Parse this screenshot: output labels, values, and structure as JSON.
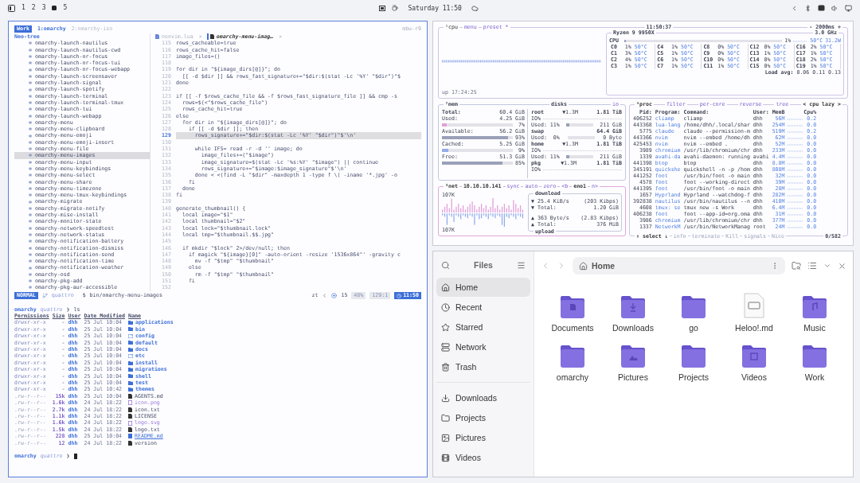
{
  "top_bar": {
    "workspaces": [
      {
        "label": "1",
        "selected": false
      },
      {
        "label": "2",
        "selected": false
      },
      {
        "label": "3",
        "selected": false
      },
      {
        "selected": true
      },
      {
        "label": "5",
        "selected": false
      }
    ],
    "clock": "Saturday 11:50"
  },
  "terminal": {
    "tmux": {
      "session": "Work",
      "windows": [
        {
          "label": "1:omarchy",
          "selected": true
        },
        {
          "label": "2:omarchy-iso",
          "selected": false
        }
      ],
      "host": "mbu-r9"
    },
    "tree": {
      "title": "Neo-tree",
      "items": [
        {
          "label": "omarchy-launch-nautilus",
          "selected": false
        },
        {
          "label": "omarchy-launch-nautilus-cwd",
          "selected": false
        },
        {
          "label": "omarchy-launch-or-focus",
          "selected": false
        },
        {
          "label": "omarchy-launch-or-focus-tui",
          "selected": false
        },
        {
          "label": "omarchy-launch-or-focus-webapp",
          "selected": false
        },
        {
          "label": "omarchy-launch-screensaver",
          "selected": false
        },
        {
          "label": "omarchy-launch-signal",
          "selected": false
        },
        {
          "label": "omarchy-launch-spotify",
          "selected": false
        },
        {
          "label": "omarchy-launch-terminal",
          "selected": false
        },
        {
          "label": "omarchy-launch-terminal-tmux",
          "selected": false
        },
        {
          "label": "omarchy-launch-tui",
          "selected": false
        },
        {
          "label": "omarchy-launch-webapp",
          "selected": false
        },
        {
          "label": "omarchy-menu",
          "selected": false
        },
        {
          "label": "omarchy-menu-clipboard",
          "selected": false
        },
        {
          "label": "omarchy-menu-emoji",
          "selected": false
        },
        {
          "label": "omarchy-menu-emoji-insert",
          "selected": false
        },
        {
          "label": "omarchy-menu-file",
          "selected": false
        },
        {
          "label": "omarchy-menu-images",
          "selected": true
        },
        {
          "label": "omarchy-menu-input",
          "selected": false
        },
        {
          "label": "omarchy-menu-keybindings",
          "selected": false
        },
        {
          "label": "omarchy-menu-select",
          "selected": false
        },
        {
          "label": "omarchy-menu-share",
          "selected": false
        },
        {
          "label": "omarchy-menu-timezone",
          "selected": false
        },
        {
          "label": "omarchy-menu-tmux-keybindings",
          "selected": false
        },
        {
          "label": "omarchy-migrate",
          "selected": false
        },
        {
          "label": "omarchy-migrate-notify",
          "selected": false
        },
        {
          "label": "omarchy-mise-install",
          "selected": false
        },
        {
          "label": "omarchy-monitor-state",
          "selected": false
        },
        {
          "label": "omarchy-network-speedtest",
          "selected": false
        },
        {
          "label": "omarchy-network-status",
          "selected": false
        },
        {
          "label": "omarchy-notification-battery",
          "selected": false
        },
        {
          "label": "omarchy-notification-dismiss",
          "selected": false
        },
        {
          "label": "omarchy-notification-send",
          "selected": false
        },
        {
          "label": "omarchy-notification-time",
          "selected": false
        },
        {
          "label": "omarchy-notification-weather",
          "selected": false
        },
        {
          "label": "omarchy-osd",
          "selected": false
        },
        {
          "label": "omarchy-pkg-add",
          "selected": false
        },
        {
          "label": "omarchy-pkg-aur-accessible",
          "selected": false
        }
      ]
    },
    "editor": {
      "tabs": [
        {
          "label": "neovim.lua",
          "close": "×",
          "selected": false
        },
        {
          "label": "omarchy-menu-imag…",
          "close": "×",
          "selected": true
        }
      ],
      "lines": [
        {
          "n": "115",
          "code": "rows_cacheable=true",
          "selected": false
        },
        {
          "n": "116",
          "code": "rows_cache_hit=false",
          "selected": false
        },
        {
          "n": "117",
          "code": "image_files=()",
          "selected": false
        },
        {
          "n": "118",
          "selected": false
        },
        {
          "n": "119",
          "code": "for dir in \"${image_dirs[@]}\"; do",
          "selected": false
        },
        {
          "n": "120",
          "code": "  [[ -d $dir ]] && rows_fast_signature+=\"$dir:$(stat -Lc '%Y' \"$dir\")\"$",
          "selected": false
        },
        {
          "n": "121",
          "code": "done",
          "selected": false
        },
        {
          "n": "122",
          "selected": false
        },
        {
          "n": "123",
          "code": "if [[ -f $rows_cache_file && -f $rows_fast_signature_file ]] && cmp -s",
          "selected": false
        },
        {
          "n": "124",
          "code": "  rows=$(<\"$rows_cache_file\")",
          "selected": false
        },
        {
          "n": "125",
          "code": "  rows_cache_hit=true",
          "selected": false
        },
        {
          "n": "126",
          "code": "else",
          "selected": false
        },
        {
          "n": "127",
          "code": "  for dir in \"${image_dirs[@]}\"; do",
          "selected": false
        },
        {
          "n": "128",
          "code": "    if [[ -d $dir ]]; then",
          "selected": false
        },
        {
          "n": "129",
          "code": "      rows_signature+=\"$dir:$(stat -Lc '%Y' \"$dir\")\"$'\\n'",
          "selected": true
        },
        {
          "n": "130",
          "selected": false
        },
        {
          "n": "131",
          "code": "      while IFS= read -r -d '' image; do",
          "selected": false
        },
        {
          "n": "132",
          "code": "        image_files+=(\"$image\")",
          "selected": false
        },
        {
          "n": "133",
          "code": "        image_signature=$(stat -Lc '%s:%Y' \"$image\") || continue",
          "selected": false
        },
        {
          "n": "134",
          "code": "        rows_signature+=\"$image:$image_signature\"$'\\n'",
          "selected": false
        },
        {
          "n": "135",
          "code": "      done < <(find -L \"$dir\" -maxdepth 1 -type f \\( -iname '*.jpg' -o",
          "selected": false
        },
        {
          "n": "136",
          "code": "    fi",
          "selected": false
        },
        {
          "n": "137",
          "code": "  done",
          "selected": false
        },
        {
          "n": "138",
          "code": "fi",
          "selected": false
        },
        {
          "n": "139",
          "selected": false
        },
        {
          "n": "140",
          "code": "generate_thumbnail() {",
          "selected": false
        },
        {
          "n": "141",
          "code": "  local image=\"$1\"",
          "selected": false
        },
        {
          "n": "142",
          "code": "  local thumbnail=\"$2\"",
          "selected": false
        },
        {
          "n": "143",
          "code": "  local lock=\"$thumbnail.lock\"",
          "selected": false
        },
        {
          "n": "144",
          "code": "  local tmp=\"$thumbnail.$$.jpg\"",
          "selected": false
        },
        {
          "n": "145",
          "selected": false
        },
        {
          "n": "146",
          "code": "  if mkdir \"$lock\" 2>/dev/null; then",
          "selected": false
        },
        {
          "n": "147",
          "code": "    if magick \"${image}[0]\" -auto-orient -resize '1536x864^' -gravity c",
          "selected": false
        },
        {
          "n": "148",
          "code": "      mv -f \"$tmp\" \"$thumbnail\"",
          "selected": false
        },
        {
          "n": "149",
          "code": "    else",
          "selected": false
        },
        {
          "n": "150",
          "code": "      rm -f \"$tmp\" \"$thumbnail\"",
          "selected": false
        },
        {
          "n": "151",
          "code": "    fi",
          "selected": false
        },
        {
          "n": "152",
          "selected": false
        }
      ]
    },
    "statusline": {
      "mode": "NORMAL",
      "branch": "quattro",
      "shell": "$",
      "file": "bin/omarchy-menu-images",
      "motion": "zt",
      "count": "15",
      "percent": "48%",
      "position": "129:1",
      "time": "11:50"
    },
    "shell": {
      "prompt": {
        "dir": "omarchy",
        "branch": "quattro",
        "symbol": "❯",
        "command": "ls"
      },
      "columns": [
        "Permissions",
        "Size",
        "User",
        "Date Modified",
        "Name"
      ],
      "rows": [
        {
          "perms": "drwxr-xr-x",
          "size": "-",
          "user": "dhh",
          "date": "25 Jul 10:04",
          "name": "applications",
          "kind": "dir"
        },
        {
          "perms": "drwxr-xr-x",
          "size": "-",
          "user": "dhh",
          "date": "25 Jul 10:04",
          "name": "bin",
          "kind": "dir"
        },
        {
          "perms": "drwxr-xr-x",
          "size": "-",
          "user": "dhh",
          "date": "25 Jul 10:04",
          "name": "config",
          "kind": "link"
        },
        {
          "perms": "drwxr-xr-x",
          "size": "-",
          "user": "dhh",
          "date": "25 Jul 10:04",
          "name": "default",
          "kind": "dir"
        },
        {
          "perms": "drwxr-xr-x",
          "size": "-",
          "user": "dhh",
          "date": "25 Jul 10:04",
          "name": "docs",
          "kind": "dir"
        },
        {
          "perms": "drwxr-xr-x",
          "size": "-",
          "user": "dhh",
          "date": "25 Jul 10:04",
          "name": "etc",
          "kind": "link"
        },
        {
          "perms": "drwxr-xr-x",
          "size": "-",
          "user": "dhh",
          "date": "25 Jul 10:04",
          "name": "install",
          "kind": "dir"
        },
        {
          "perms": "drwxr-xr-x",
          "size": "-",
          "user": "dhh",
          "date": "25 Jul 10:04",
          "name": "migrations",
          "kind": "dir"
        },
        {
          "perms": "drwxr-xr-x",
          "size": "-",
          "user": "dhh",
          "date": "25 Jul 10:04",
          "name": "shell",
          "kind": "dir"
        },
        {
          "perms": "drwxr-xr-x",
          "size": "-",
          "user": "dhh",
          "date": "25 Jul 10:04",
          "name": "test",
          "kind": "dir"
        },
        {
          "perms": "drwxr-xr-x",
          "size": "-",
          "user": "dhh",
          "date": "25 Jul 10:42",
          "name": "themes",
          "kind": "dir"
        },
        {
          "perms": ".rw-r--r--",
          "size": "15k",
          "user": "dhh",
          "date": "25 Jul 10:04",
          "name": "AGENTS.md",
          "kind": "file"
        },
        {
          "perms": ".rw-r--r--",
          "size": "1.6k",
          "user": "dhh",
          "date": "24 Jul 18:22",
          "name": "icon.png",
          "kind": "image"
        },
        {
          "perms": ".rw-r--r--",
          "size": "2.7k",
          "user": "dhh",
          "date": "24 Jul 18:22",
          "name": "icon.txt",
          "kind": "file"
        },
        {
          "perms": ".rw-r--r--",
          "size": "1.1k",
          "user": "dhh",
          "date": "24 Jul 18:22",
          "name": "LICENSE",
          "kind": "file"
        },
        {
          "perms": ".rw-r--r--",
          "size": "1.6k",
          "user": "dhh",
          "date": "24 Jul 18:22",
          "name": "logo.svg",
          "kind": "image"
        },
        {
          "perms": ".rw-r--r--",
          "size": "1.5k",
          "user": "dhh",
          "date": "24 Jul 18:22",
          "name": "logo.txt",
          "kind": "file"
        },
        {
          "perms": ".rw-r--r--",
          "size": "228",
          "user": "dhh",
          "date": "25 Jul 10:04",
          "name": "README.md",
          "kind": "doc"
        },
        {
          "perms": ".rw-r--r--",
          "size": "12",
          "user": "dhh",
          "date": "24 Jul 18:22",
          "name": "version",
          "kind": "file"
        }
      ],
      "prompt2": {
        "dir": "omarchy",
        "branch": "quattro",
        "symbol": "❯"
      }
    }
  },
  "btop": {
    "cpu": {
      "tabs": [
        "¹cpu",
        "menu",
        "preset *"
      ],
      "clock": "11:50:37",
      "interval": "- 2000ms +",
      "model": "Ryzen 9 9950X",
      "freq": "3.0 GHz",
      "total": {
        "label": "CPU",
        "level": 0.01,
        "pct": "1%",
        "temp": "50°C",
        "power": "31.2W"
      },
      "cores": [
        {
          "name": "C0",
          "pct": "1%",
          "temp": "50°C"
        },
        {
          "name": "C1",
          "pct": "3%",
          "temp": "50°C"
        },
        {
          "name": "C2",
          "pct": "4%",
          "temp": "50°C"
        },
        {
          "name": "C3",
          "pct": "1%",
          "temp": "50°C"
        },
        {
          "name": "C4",
          "pct": "1%",
          "temp": "50°C"
        },
        {
          "name": "C5",
          "pct": "1%",
          "temp": "50°C"
        },
        {
          "name": "C6",
          "pct": "1%",
          "temp": "50°C"
        },
        {
          "name": "C7",
          "pct": "1%",
          "temp": "50°C"
        },
        {
          "name": "C8",
          "pct": "0%",
          "temp": "50°C"
        },
        {
          "name": "C9",
          "pct": "0%",
          "temp": "50°C"
        },
        {
          "name": "C10",
          "pct": "0%",
          "temp": "50°C"
        },
        {
          "name": "C11",
          "pct": "1%",
          "temp": "50°C"
        },
        {
          "name": "C12",
          "pct": "0%",
          "temp": "50°C"
        },
        {
          "name": "C13",
          "pct": "1%",
          "temp": "50°C"
        },
        {
          "name": "C14",
          "pct": "0%",
          "temp": "50°C"
        },
        {
          "name": "C15",
          "pct": "0%",
          "temp": "50°C"
        },
        {
          "name": "C16",
          "pct": "2%",
          "temp": "50°C"
        },
        {
          "name": "C17",
          "pct": "1%",
          "temp": "50°C"
        },
        {
          "name": "C18",
          "pct": "2%",
          "temp": "50°C"
        },
        {
          "name": "C19",
          "pct": "1%",
          "temp": "50°C"
        }
      ],
      "load_label": "Load avg:",
      "load": "0.06 0.11 0.13",
      "uptime": "up 17:24:25"
    },
    "mem": {
      "title": "²mem",
      "rows": [
        {
          "label": "Total:",
          "value": "60.4 GiB"
        },
        {
          "label": "Used:",
          "value": "4.25 GiB",
          "pct": "7%",
          "level": 0.07
        },
        {
          "label": "Available:",
          "value": "56.2 GiB",
          "pct": "93%",
          "level": 0.93
        },
        {
          "label": "Cached:",
          "value": "5.25 GiB",
          "pct": "9%",
          "level": 0.09
        },
        {
          "label": "Free:",
          "value": "51.3 GiB",
          "pct": "85%",
          "level": 0.85
        }
      ]
    },
    "disks": {
      "title": "disks",
      "io": "io",
      "rows": [
        {
          "kind": "disk",
          "name": "root",
          "rate": "▼1.3M",
          "size": "1.81 TiB"
        },
        {
          "kind": "io",
          "label": "IO%"
        },
        {
          "kind": "used",
          "label": "Used: 11%",
          "level": 0.11,
          "size": "211 GiB"
        },
        {
          "kind": "disk",
          "name": "swap",
          "size": "64.4 GiB"
        },
        {
          "kind": "used",
          "label": "Used:  0%",
          "size": "0 Byte"
        },
        {
          "kind": "disk",
          "name": "home",
          "rate": "▼1.3M",
          "size": "1.81 TiB"
        },
        {
          "kind": "io",
          "label": "IO%"
        },
        {
          "kind": "used",
          "label": "Used: 11%",
          "level": 0.11,
          "size": "211 GiB"
        },
        {
          "kind": "disk",
          "name": "pkg",
          "rate": "▼1.3M",
          "size": "1.81 TiB"
        },
        {
          "kind": "io",
          "label": "IO%"
        }
      ]
    },
    "net": {
      "tabs": [
        "³net",
        "10.10.10.141",
        "sync",
        "auto",
        "zero",
        "<b",
        "eno1",
        "n>"
      ],
      "scale_top": "107K",
      "scale_bottom": "107K",
      "download": {
        "title": "download",
        "rate": "▼ 25.4 KiB/s",
        "bits": "(203 Kibps)",
        "total_label": "▼ Total:",
        "total": "1.20 GiB"
      },
      "upload": {
        "title": "upload",
        "rate": "▲ 363 Byte/s",
        "bits": "(2.83 Kibps)",
        "total_label": "▲ Total:",
        "total": "376 MiB"
      }
    },
    "proc": {
      "tabs": [
        "⁴proc",
        "filter",
        "per-core",
        "reverse",
        "tree",
        "< cpu lazy >"
      ],
      "columns": [
        "Pid:",
        "Program:",
        "Command:",
        "User:",
        "MemB",
        "Cpu%"
      ],
      "rows": [
        {
          "pid": "406252",
          "program": "cliamp",
          "command": "cliamp",
          "user": "dhh",
          "mem": "56M",
          "cpu": "0.2"
        },
        {
          "pid": "443368",
          "program": "lua-lang",
          "command": "/home/dhh/.local/shar",
          "user": "dhh",
          "mem": "254M",
          "cpu": "0.0"
        },
        {
          "pid": "5775",
          "program": "claude",
          "command": "claude --permission-m",
          "user": "dhh",
          "mem": "519M",
          "cpu": "0.2"
        },
        {
          "pid": "443366",
          "program": "nvim",
          "command": "nvim --embed /home/dh",
          "user": "dhh",
          "mem": "62M",
          "cpu": "0.0"
        },
        {
          "pid": "425453",
          "program": "nvim",
          "command": "nvim --embed .",
          "user": "dhh",
          "mem": "52M",
          "cpu": "0.0"
        },
        {
          "pid": "3989",
          "program": "chromium",
          "command": "/usr/lib/chromium/chr",
          "user": "dhh",
          "mem": "233M",
          "cpu": "0.0"
        },
        {
          "pid": "1339",
          "program": "avahi-da",
          "command": "avahi-daemon: running",
          "user": "avahi",
          "mem": "4.4M",
          "cpu": "0.0"
        },
        {
          "pid": "441398",
          "program": "btop",
          "command": "btop",
          "user": "dhh",
          "mem": "8.8M",
          "cpu": "0.0"
        },
        {
          "pid": "345191",
          "program": "quickshe",
          "command": "quickshell -n -p /hom",
          "user": "dhh",
          "mem": "808M",
          "cpu": "0.0"
        },
        {
          "pid": "441252",
          "program": "foot",
          "command": "/usr/bin/foot -o main",
          "user": "dhh",
          "mem": "32M",
          "cpu": "0.0"
        },
        {
          "pid": "4578",
          "program": "foot",
          "command": "foot --working-direct",
          "user": "dhh",
          "mem": "39M",
          "cpu": "0.0"
        },
        {
          "pid": "441395",
          "program": "foot",
          "command": "/usr/bin/foot -o main",
          "user": "dhh",
          "mem": "28M",
          "cpu": "0.0"
        },
        {
          "pid": "1657",
          "program": "Hyprland",
          "command": "Hyprland --watchdog-f",
          "user": "dhh",
          "mem": "282M",
          "cpu": "0.0"
        },
        {
          "pid": "392838",
          "program": "nautilus",
          "command": "/usr/bin/nautilus --n",
          "user": "dhh",
          "mem": "410M",
          "cpu": "0.0"
        },
        {
          "pid": "4608",
          "program": "tmux: se",
          "command": "tmux new -s Work",
          "user": "dhh",
          "mem": "6.4M",
          "cpu": "0.0"
        },
        {
          "pid": "406238",
          "program": "foot",
          "command": "foot --app-id=org.oma",
          "user": "dhh",
          "mem": "31M",
          "cpu": "0.0"
        },
        {
          "pid": "3986",
          "program": "chromium",
          "command": "/usr/lib/chromium/chr",
          "user": "dhh",
          "mem": "377M",
          "cpu": "0.0"
        },
        {
          "pid": "1337",
          "program": "NetworkM",
          "command": "/usr/bin/NetworkManag",
          "user": "root",
          "mem": "24M",
          "cpu": "0.0"
        }
      ],
      "footer": [
        "↑ select ↓",
        "info",
        "terminate",
        "Kill",
        "signals",
        "Nice"
      ],
      "count": "0/582"
    }
  },
  "files": {
    "title": "Files",
    "places": [
      {
        "label": "Home",
        "selected": true
      },
      {
        "label": "Recent",
        "selected": false
      },
      {
        "label": "Starred",
        "selected": false
      },
      {
        "label": "Network",
        "selected": false
      },
      {
        "label": "Trash",
        "selected": false
      }
    ],
    "bookmarks": [
      {
        "label": "Downloads",
        "selected": false
      },
      {
        "label": "Projects",
        "selected": false
      },
      {
        "label": "Pictures",
        "selected": false
      },
      {
        "label": "Videos",
        "selected": false
      }
    ],
    "path": "Home",
    "items": [
      {
        "label": "Documents",
        "kind": "folder"
      },
      {
        "label": "Downloads",
        "kind": "folder"
      },
      {
        "label": "go",
        "kind": "folder"
      },
      {
        "label": "Heloo!.md",
        "kind": "file"
      },
      {
        "label": "Music",
        "kind": "folder"
      },
      {
        "label": "omarchy",
        "kind": "folder"
      },
      {
        "label": "Pictures",
        "kind": "folder"
      },
      {
        "label": "Projects",
        "kind": "folder"
      },
      {
        "label": "Videos",
        "kind": "folder"
      },
      {
        "label": "Work",
        "kind": "folder"
      }
    ]
  }
}
